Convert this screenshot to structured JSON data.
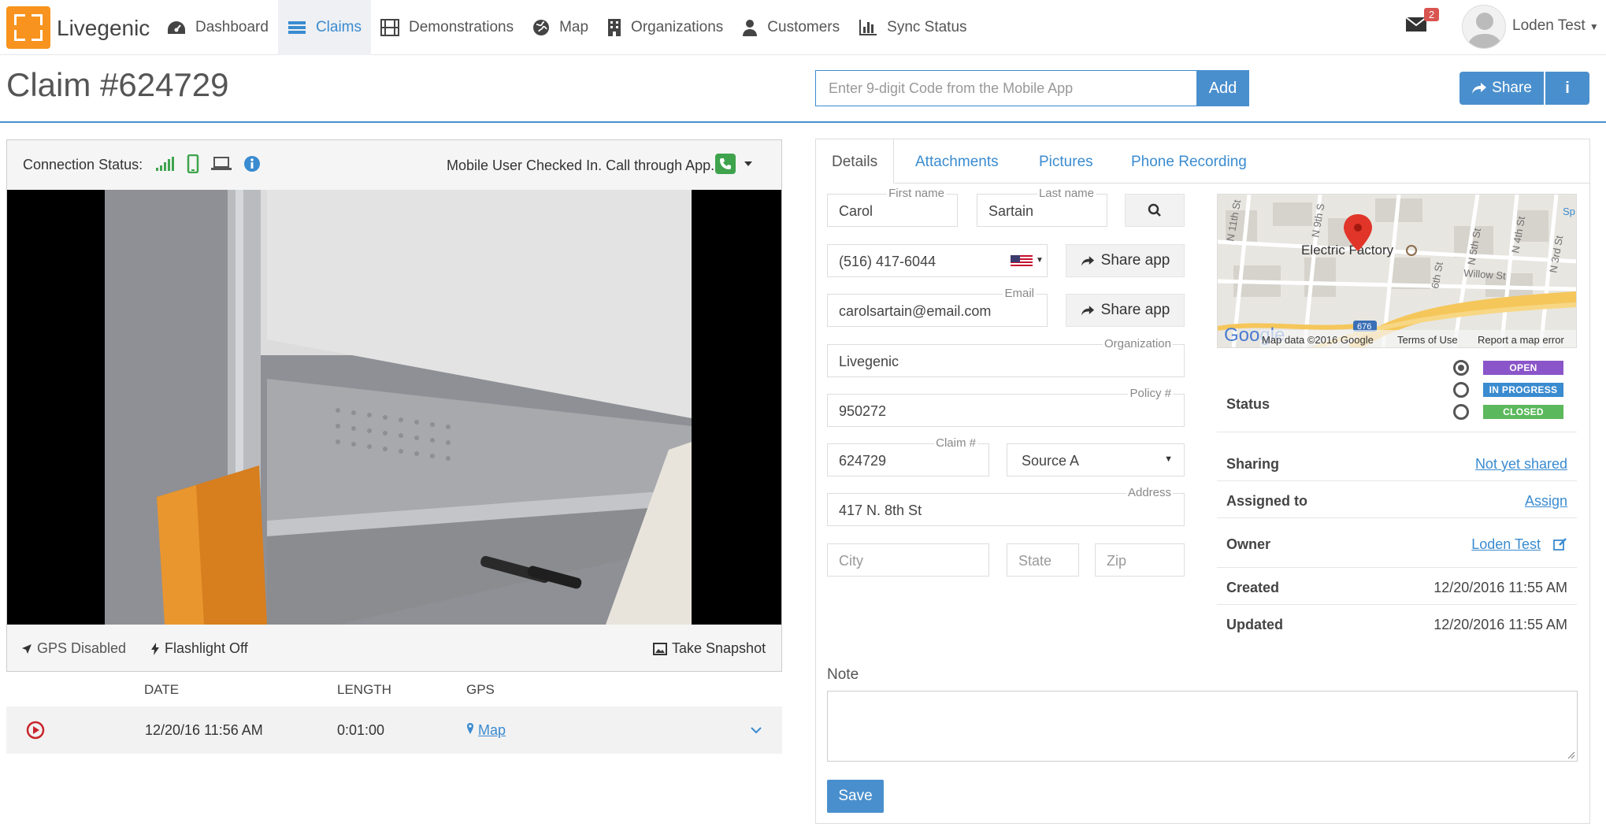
{
  "app": {
    "brand": "Livegenic",
    "user_name": "Loden Test",
    "mail_count": "2"
  },
  "nav": {
    "dashboard": "Dashboard",
    "claims": "Claims",
    "demonstrations": "Demonstrations",
    "map": "Map",
    "organizations": "Organizations",
    "customers": "Customers",
    "sync_status": "Sync Status"
  },
  "header": {
    "title": "Claim #624729",
    "code_placeholder": "Enter 9-digit Code from the Mobile App",
    "add_label": "Add",
    "share_label": "Share",
    "info_label": "i"
  },
  "connection": {
    "label": "Connection Status:",
    "checkin_text": "Mobile User Checked In. Call through App."
  },
  "video_controls": {
    "gps": "GPS Disabled",
    "flashlight": "Flashlight Off",
    "snapshot": "Take Snapshot"
  },
  "recordings": {
    "headers": {
      "date": "DATE",
      "length": "LENGTH",
      "gps": "GPS"
    },
    "rows": [
      {
        "date": "12/20/16 11:56 AM",
        "length": "0:01:00",
        "gps": "Map"
      }
    ]
  },
  "tabs": {
    "details": "Details",
    "attachments": "Attachments",
    "pictures": "Pictures",
    "phone_recording": "Phone Recording"
  },
  "form": {
    "first_name": {
      "label": "First name",
      "value": "Carol"
    },
    "last_name": {
      "label": "Last name",
      "value": "Sartain"
    },
    "phone": {
      "value": "(516) 417-6044"
    },
    "share_app_label": "Share app",
    "email": {
      "label": "Email",
      "value": "carolsartain@email.com"
    },
    "organization": {
      "label": "Organization",
      "value": "Livegenic"
    },
    "policy": {
      "label": "Policy #",
      "value": "950272"
    },
    "claim": {
      "label": "Claim #",
      "value": "624729"
    },
    "source": {
      "value": "Source A"
    },
    "address": {
      "label": "Address",
      "value": "417 N. 8th St"
    },
    "city": {
      "placeholder": "City"
    },
    "state": {
      "placeholder": "State"
    },
    "zip": {
      "placeholder": "Zip"
    }
  },
  "map": {
    "place_label": "Electric Factory",
    "streets": [
      "N 11th St",
      "N 9th S",
      "N 5th St",
      "N 4th St",
      "N 3rd St",
      "6th St",
      "Willow St",
      "Sp"
    ],
    "highway": "676",
    "attribution": "Map data ©2016 Google",
    "terms": "Terms of Use",
    "report": "Report a map error",
    "google": "Google"
  },
  "details": {
    "status_label": "Status",
    "statuses": [
      {
        "label": "OPEN",
        "color": "#8a55c9",
        "selected": true
      },
      {
        "label": "IN PROGRESS",
        "color": "#3a8bd0",
        "selected": false
      },
      {
        "label": "CLOSED",
        "color": "#5cb85c",
        "selected": false
      }
    ],
    "sharing": {
      "key": "Sharing",
      "value": "Not yet shared"
    },
    "assigned": {
      "key": "Assigned to",
      "value": "Assign"
    },
    "owner": {
      "key": "Owner",
      "value": "Loden Test"
    },
    "created": {
      "key": "Created",
      "value": "12/20/2016 11:55 AM"
    },
    "updated": {
      "key": "Updated",
      "value": "12/20/2016 11:55 AM"
    }
  },
  "note": {
    "label": "Note",
    "save_label": "Save"
  },
  "colors": {
    "accent": "#4a8fcd",
    "brand": "#f7931e",
    "phone_green": "#3fa34d",
    "record_red": "#c9252c"
  }
}
